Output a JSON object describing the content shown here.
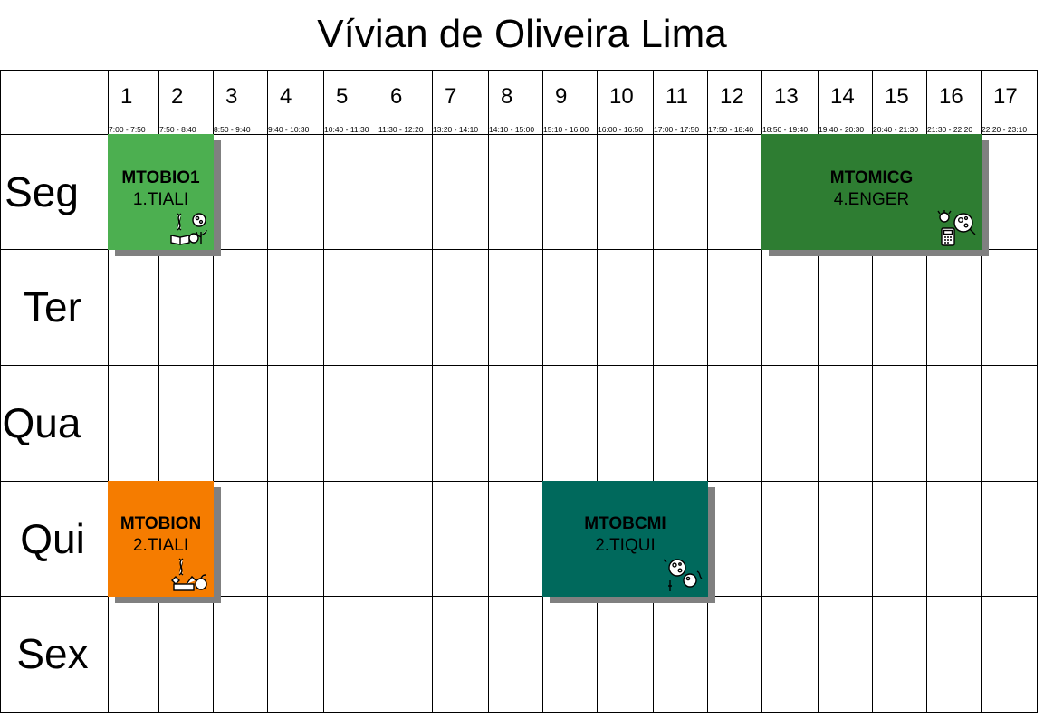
{
  "title": "Vívian de Oliveira Lima",
  "periods": [
    {
      "num": "1",
      "time": "7:00 - 7:50"
    },
    {
      "num": "2",
      "time": "7:50 - 8:40"
    },
    {
      "num": "3",
      "time": "8:50 - 9:40"
    },
    {
      "num": "4",
      "time": "9:40 - 10:30"
    },
    {
      "num": "5",
      "time": "10:40 - 11:30"
    },
    {
      "num": "6",
      "time": "11:30 - 12:20"
    },
    {
      "num": "7",
      "time": "13:20 - 14:10"
    },
    {
      "num": "8",
      "time": "14:10 - 15:00"
    },
    {
      "num": "9",
      "time": "15:10 - 16:00"
    },
    {
      "num": "10",
      "time": "16:00 - 16:50"
    },
    {
      "num": "11",
      "time": "17:00 - 17:50"
    },
    {
      "num": "12",
      "time": "17:50 - 18:40"
    },
    {
      "num": "13",
      "time": "18:50 - 19:40"
    },
    {
      "num": "14",
      "time": "19:40 - 20:30"
    },
    {
      "num": "15",
      "time": "20:40 - 21:30"
    },
    {
      "num": "16",
      "time": "21:30 - 22:20"
    },
    {
      "num": "17",
      "time": "22:20 - 23:10"
    }
  ],
  "days": [
    "Seg",
    "Ter",
    "Qua",
    "Qui",
    "Sex"
  ],
  "classes": [
    {
      "code": "MTOBIO1",
      "group": "1.TIALI",
      "color": "#4caf50",
      "icon": "biology-icon"
    },
    {
      "code": "MTOMICG",
      "group": "4.ENGER",
      "color": "#2e7d32",
      "icon": "microbiology-calculator-icon"
    },
    {
      "code": "MTOBION",
      "group": "2.TIALI",
      "color": "#f57c00",
      "icon": "biotech-food-icon"
    },
    {
      "code": "MTOBCMI",
      "group": "2.TIQUI",
      "color": "#00695c",
      "icon": "microbes-icon"
    }
  ]
}
